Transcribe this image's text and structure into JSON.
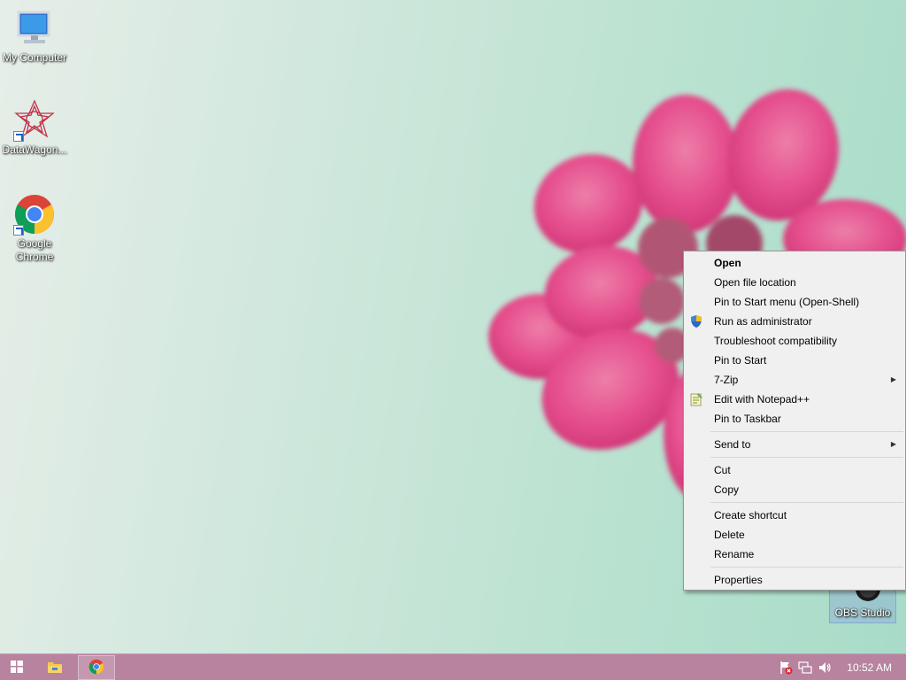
{
  "desktop": {
    "icons": [
      {
        "label": "My Computer",
        "icon": "computer-icon"
      },
      {
        "label": "DataWagon...",
        "icon": "datawagon-icon"
      },
      {
        "label": "Google Chrome",
        "icon": "chrome-icon"
      },
      {
        "label": "OBS Studio",
        "icon": "obs-icon"
      }
    ]
  },
  "context_menu": {
    "items": [
      {
        "label": "Open",
        "bold": true
      },
      {
        "label": "Open file location"
      },
      {
        "label": "Pin to Start menu (Open-Shell)"
      },
      {
        "label": "Run as administrator",
        "icon": "uac-shield-icon"
      },
      {
        "label": "Troubleshoot compatibility"
      },
      {
        "label": "Pin to Start"
      },
      {
        "label": "7-Zip",
        "submenu": true
      },
      {
        "label": "Edit with Notepad++",
        "icon": "notepadpp-icon"
      },
      {
        "label": "Pin to Taskbar"
      },
      {
        "label": "Send to",
        "submenu": true
      },
      {
        "label": "Cut"
      },
      {
        "label": "Copy"
      },
      {
        "label": "Create shortcut"
      },
      {
        "label": "Delete"
      },
      {
        "label": "Rename"
      },
      {
        "label": "Properties"
      }
    ]
  },
  "taskbar": {
    "buttons": [
      {
        "icon": "windows-start-icon"
      },
      {
        "icon": "file-explorer-icon"
      },
      {
        "icon": "chrome-icon"
      }
    ],
    "tray_icons": [
      "action-center-flag-icon",
      "network-icon",
      "volume-icon"
    ],
    "clock": "10:52 AM"
  },
  "colors": {
    "taskbar": "#b7839e",
    "menu_bg": "#f0f0f0",
    "flower": "#e8528a"
  }
}
